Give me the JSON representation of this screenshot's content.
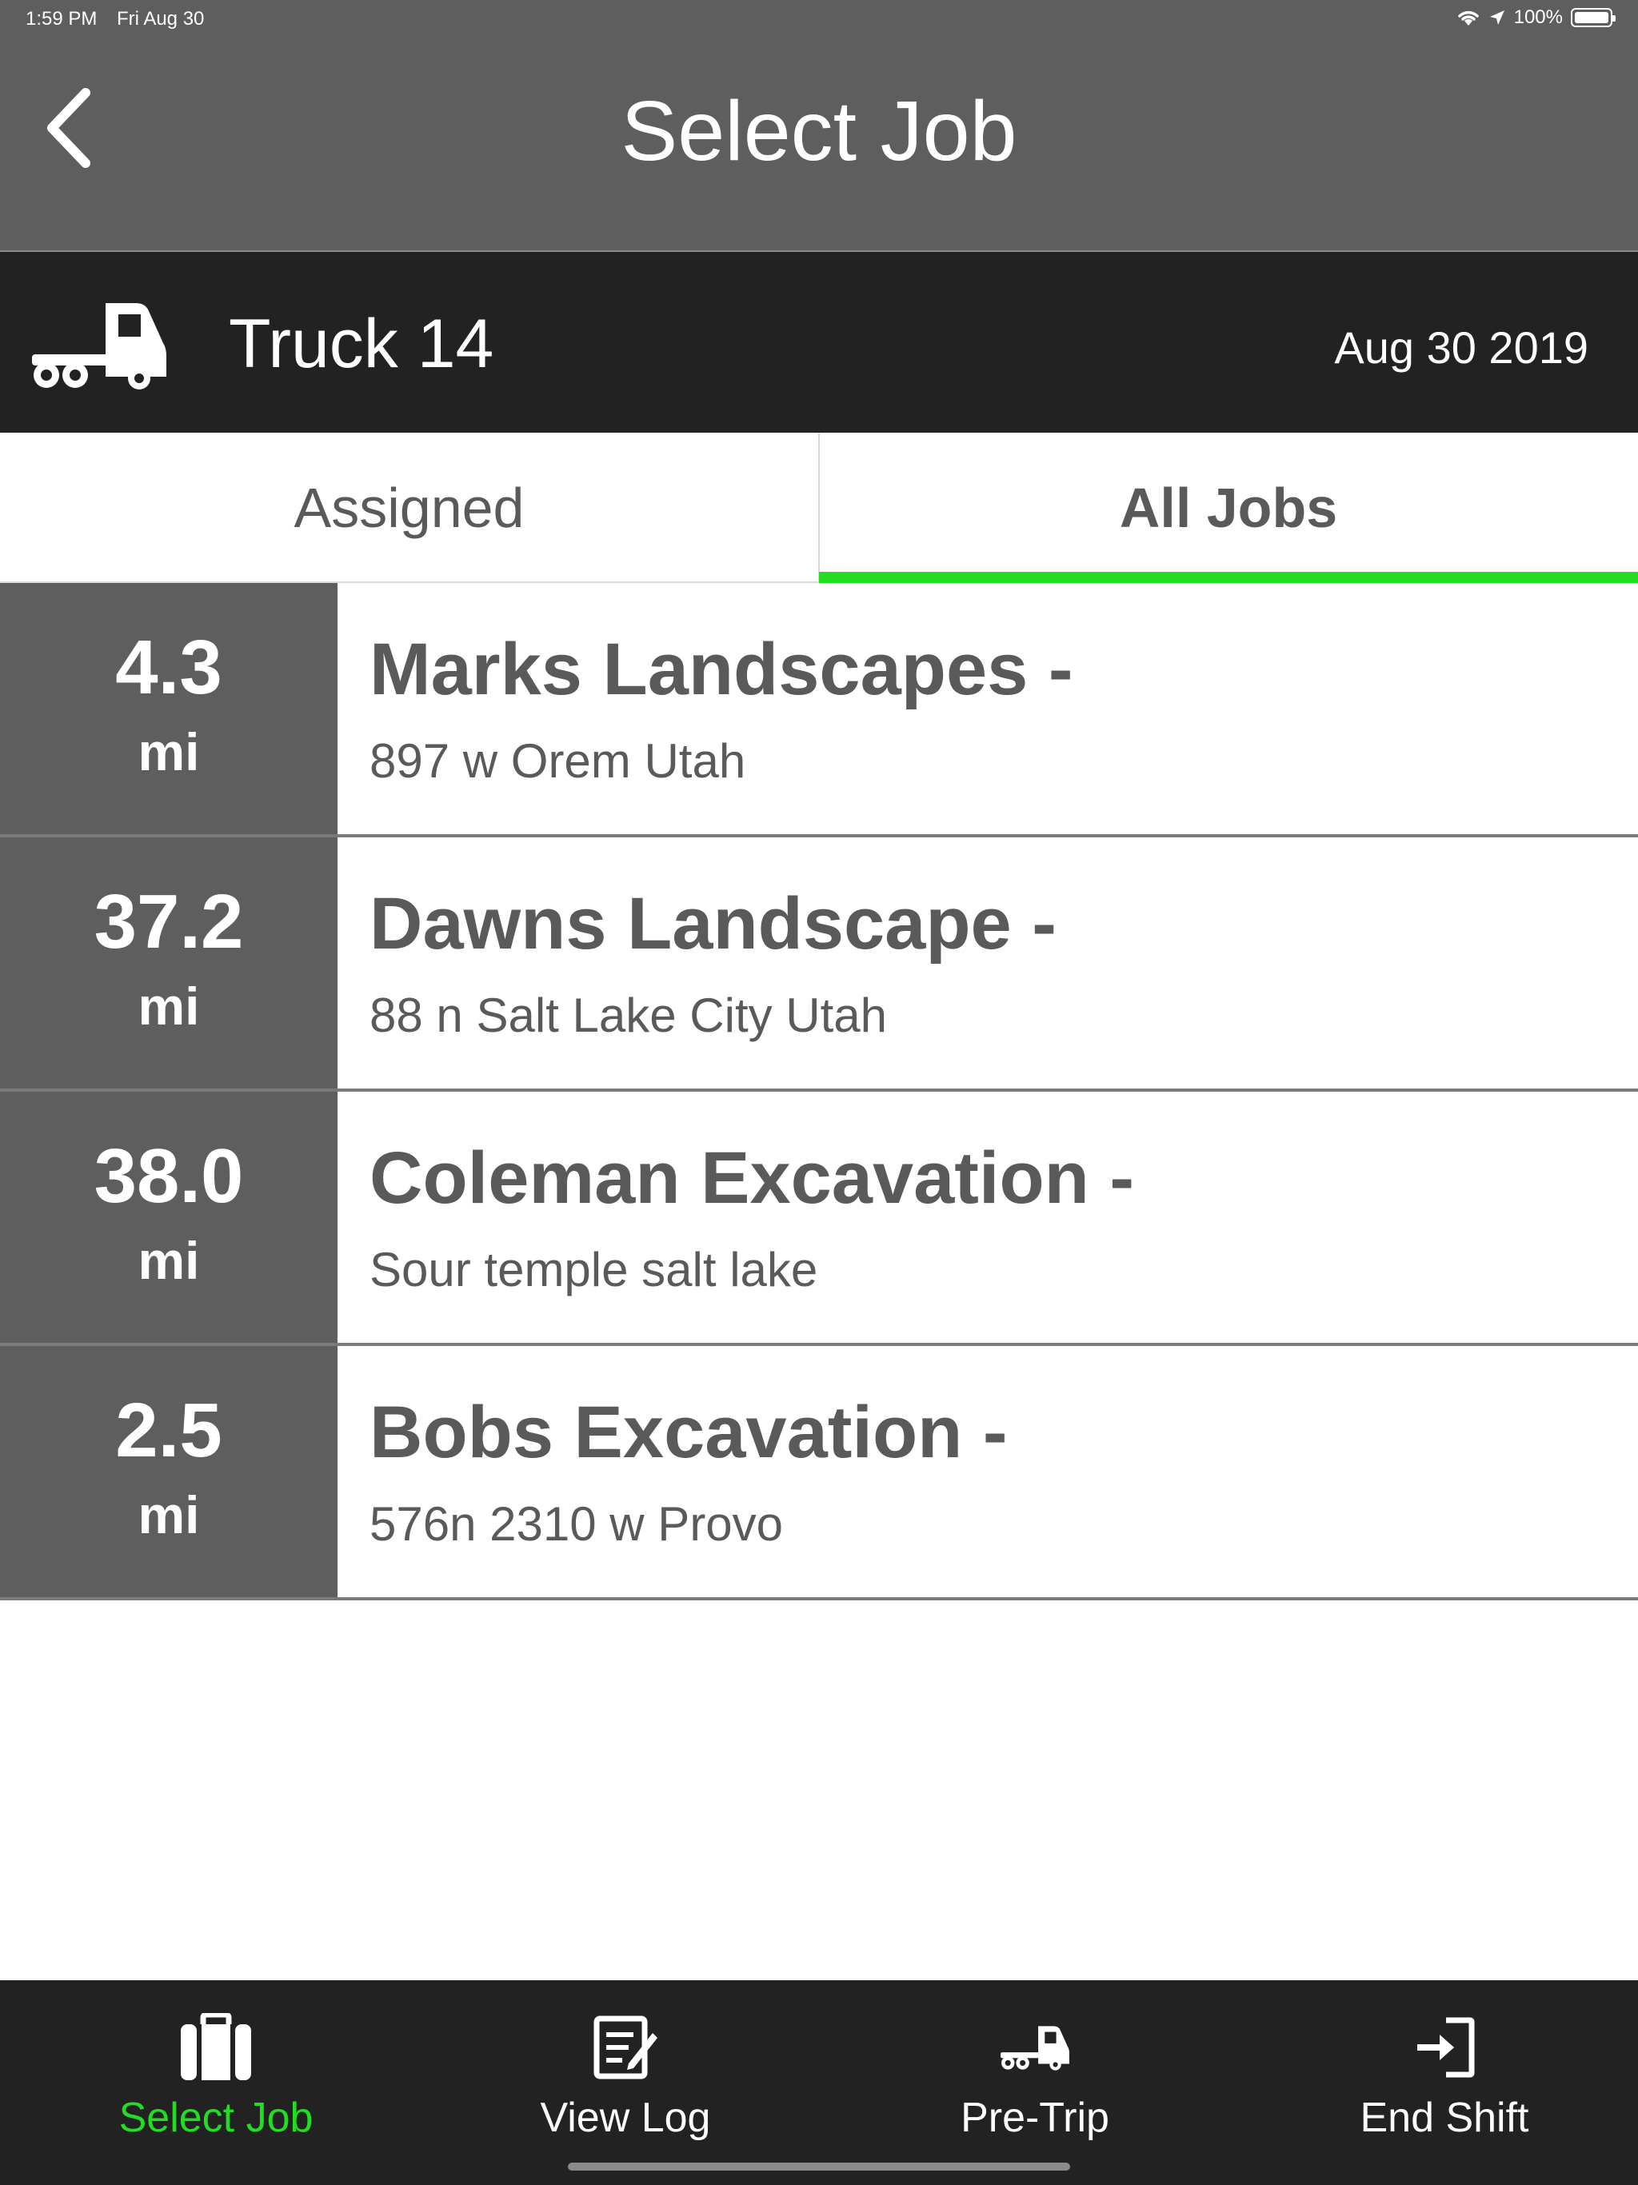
{
  "status_bar": {
    "time": "1:59 PM",
    "date": "Fri Aug 30",
    "battery": "100%",
    "icons": [
      "wifi-icon",
      "location-arrow-icon",
      "battery-icon"
    ]
  },
  "header": {
    "title": "Select Job",
    "back_icon": "chevron-left-icon"
  },
  "truck_bar": {
    "truck_name": "Truck 14",
    "date": "Aug 30 2019",
    "icon": "truck-icon"
  },
  "tabs": {
    "assigned": "Assigned",
    "all_jobs": "All Jobs",
    "active": "all_jobs"
  },
  "jobs": [
    {
      "distance": "4.3",
      "unit": "mi",
      "name": "Marks Landscapes -",
      "address": "897 w Orem Utah"
    },
    {
      "distance": "37.2",
      "unit": "mi",
      "name": "Dawns Landscape -",
      "address": "88 n Salt Lake City Utah"
    },
    {
      "distance": "38.0",
      "unit": "mi",
      "name": "Coleman Excavation -",
      "address": "Sour temple salt lake"
    },
    {
      "distance": "2.5",
      "unit": "mi",
      "name": "Bobs Excavation -",
      "address": "576n 2310 w Provo"
    }
  ],
  "bottom_tabs": [
    {
      "label": "Select Job",
      "icon": "briefcase-icon",
      "active": true
    },
    {
      "label": "View Log",
      "icon": "log-icon",
      "active": false
    },
    {
      "label": "Pre-Trip",
      "icon": "truck-icon",
      "active": false
    },
    {
      "label": "End Shift",
      "icon": "sign-in-icon",
      "active": false
    }
  ],
  "colors": {
    "header_bg": "#5e5e5e",
    "truck_bar_bg": "#222222",
    "accent_green": "#22dd22",
    "distance_bg": "#5e5e5e",
    "text_gray": "#5a5a5a"
  }
}
